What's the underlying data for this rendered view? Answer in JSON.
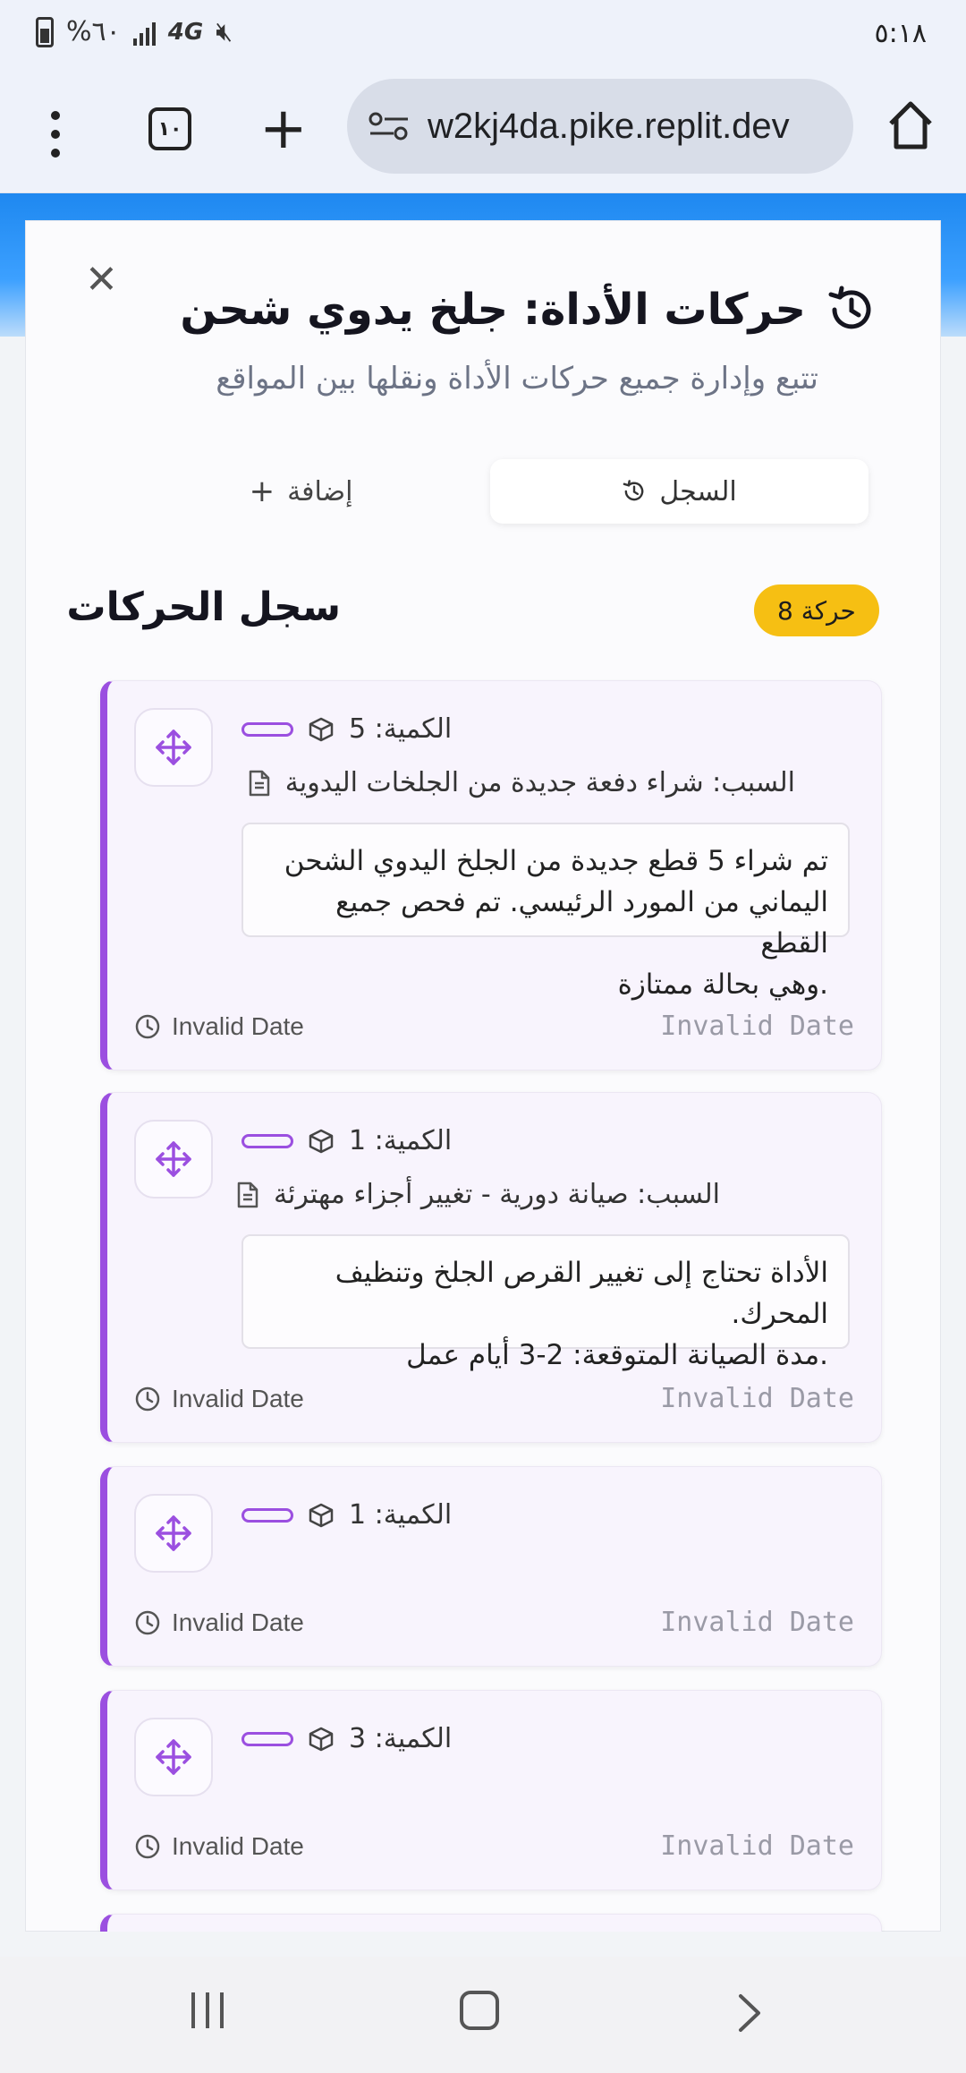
{
  "status_bar": {
    "time": "٥:١٨",
    "battery_text": "%٦٠",
    "network": "4G"
  },
  "browser": {
    "tabs_count": "١٠",
    "url": "w2kj4da.pike.replit.dev"
  },
  "modal": {
    "title": "حركات الأداة: جلخ يدوي شحن",
    "subtitle": "تتبع وإدارة جميع حركات الأداة ونقلها بين المواقع",
    "tabs": [
      {
        "label": "السجل",
        "active": true
      },
      {
        "label": "إضافة",
        "active": false
      }
    ],
    "section_title": "سجل الحركات",
    "count_badge": "حركة 8"
  },
  "movements": [
    {
      "quantity": "الكمية: 5",
      "reason": "السبب: شراء دفعة جديدة من الجلخات اليدوية",
      "notes": [
        "تم شراء 5 قطع جديدة من الجلخ اليدوي الشحن",
        "اليماني من المورد الرئيسي. تم فحص جميع القطع",
        ".وهي بحالة ممتازة"
      ],
      "date_left": "Invalid Date",
      "date_right": "Invalid Date"
    },
    {
      "quantity": "الكمية: 1",
      "reason": "السبب: صيانة دورية - تغيير أجزاء مهترئة",
      "notes": [
        "الأداة تحتاج إلى تغيير القرص الجلخ وتنظيف المحرك.",
        ".مدة الصيانة المتوقعة: 2-3 أيام عمل"
      ],
      "date_left": "Invalid Date",
      "date_right": "Invalid Date"
    },
    {
      "quantity": "الكمية: 1",
      "date_left": "Invalid Date",
      "date_right": "Invalid Date"
    },
    {
      "quantity": "الكمية: 3",
      "date_left": "Invalid Date",
      "date_right": "Invalid Date"
    }
  ],
  "colors": {
    "accent": "#9b4fe0",
    "badge": "#f6bf13",
    "banner": "#1e88f0"
  }
}
